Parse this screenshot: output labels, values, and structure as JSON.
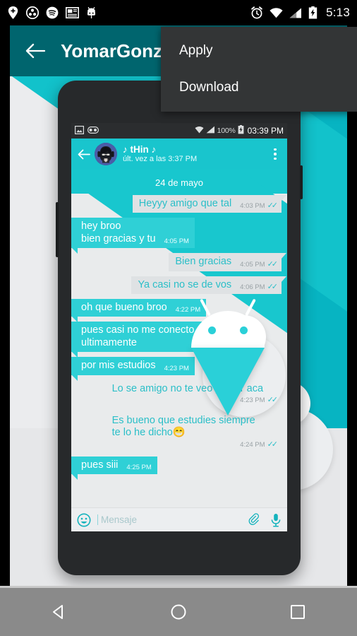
{
  "system_status_bar": {
    "icons_left": [
      "location-pin-plus-icon",
      "soccer-ball-icon",
      "spotify-icon",
      "news-layout-icon",
      "android-head-icon"
    ],
    "icons_right": [
      "alarm-clock-icon",
      "wifi-icon",
      "signal-icon",
      "battery-charging-icon"
    ],
    "time": "5:13"
  },
  "appbar": {
    "back_icon": "arrow-left-icon",
    "title": "YomarGonz"
  },
  "overflow_menu": {
    "items": [
      {
        "label": "Apply"
      },
      {
        "label": "Download"
      }
    ]
  },
  "preview": {
    "phone_status_bar": {
      "icons_left": [
        "screenshot-image-icon",
        "voicemail-icon"
      ],
      "icons_right": [
        "wifi-icon",
        "signal-icon"
      ],
      "battery_percent": "100%",
      "battery_icon": "battery-charging-icon",
      "clock": "03:39 PM"
    },
    "chat_header": {
      "back_icon": "arrow-left-icon",
      "avatar": "contact-avatar",
      "name": "♪ tHin ♪",
      "status": "últ. vez a las 3:37 PM",
      "overflow_icon": "more-vertical-icon"
    },
    "date_divider": "24 de mayo",
    "messages": [
      {
        "dir": "out",
        "text": "Heyyy amigo que tal",
        "time": "4:03 PM",
        "ticks": "✓✓",
        "ghost": false
      },
      {
        "dir": "in",
        "text": "hey broo\nbien gracias y tu",
        "time": "4:05 PM",
        "ticks": "",
        "ghost": false
      },
      {
        "dir": "out",
        "text": "Bien gracias",
        "time": "4:05 PM",
        "ticks": "✓✓",
        "ghost": false
      },
      {
        "dir": "out",
        "text": "Ya casi no se de vos",
        "time": "4:06 PM",
        "ticks": "✓✓",
        "ghost": false
      },
      {
        "dir": "in",
        "text": "oh que bueno broo",
        "time": "4:22 PM",
        "ticks": "",
        "ghost": false
      },
      {
        "dir": "in",
        "text": "pues casi no me conecto\nultimamente",
        "time": "4:23 PM",
        "ticks": "",
        "ghost": false
      },
      {
        "dir": "in",
        "text": "por mis estudios",
        "time": "4:23 PM",
        "ticks": "",
        "ghost": false
      },
      {
        "dir": "out",
        "text": "Lo se amigo no te veo ya por aca",
        "time": "4:23 PM",
        "ticks": "✓✓",
        "ghost": true
      },
      {
        "dir": "out",
        "text": "Es bueno que estudies siempre\nte lo he dicho😁",
        "time": "4:24 PM",
        "ticks": "✓✓",
        "ghost": true
      },
      {
        "dir": "in",
        "text": "pues siii",
        "time": "4:25 PM",
        "ticks": "",
        "ghost": false
      }
    ],
    "input_bar": {
      "emoji_icon": "emoji-smiley-icon",
      "placeholder": "Mensaje",
      "attach_icon": "paperclip-icon",
      "mic_icon": "microphone-icon"
    },
    "overlay_graphic": "android-robot-icon"
  },
  "navbar": {
    "back_icon": "nav-back-triangle-icon",
    "home_icon": "nav-home-circle-icon",
    "recents_icon": "nav-recents-square-icon"
  },
  "colors": {
    "appbar": "#00656e",
    "accent_teal": "#19c5cd",
    "menu_bg": "#333536",
    "navbar": "#8a8a8a",
    "bubble_out": "#dfe2e4",
    "bubble_in": "#2fd0d6",
    "out_text": "#2bbfc8"
  }
}
